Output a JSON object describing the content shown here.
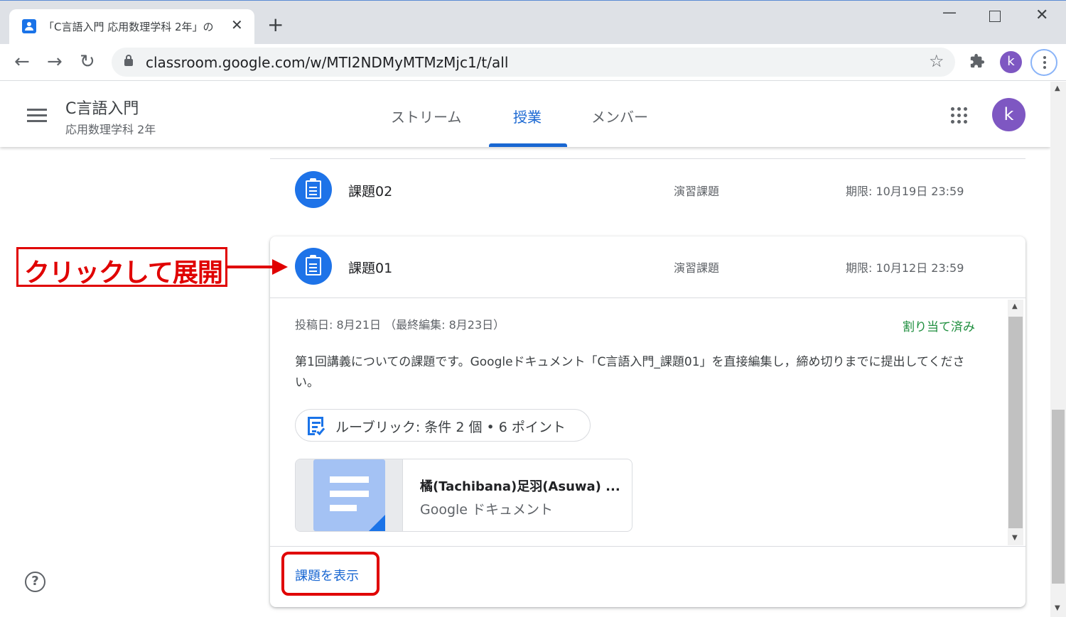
{
  "browser": {
    "tab_title": "「C言語入門 応用数理学科 2年」の",
    "tab_close": "✕",
    "new_tab": "+",
    "url": "classroom.google.com/w/MTI2NDMyMTMzMjc1/t/all",
    "profile_initial": "k",
    "window_controls": {
      "minimize": "—",
      "close": "✕"
    },
    "nav": {
      "back": "←",
      "forward": "→",
      "reload": "↻",
      "star": "☆"
    }
  },
  "classroom": {
    "class_name": "C言語入門",
    "class_section": "応用数理学科 2年",
    "tabs": [
      "ストリーム",
      "授業",
      "メンバー"
    ],
    "active_tab": "授業",
    "avatar_initial": "k",
    "help": "?"
  },
  "assignments": [
    {
      "title": "課題02",
      "topic": "演習課題",
      "due": "期限: 10月19日 23:59"
    },
    {
      "title": "課題01",
      "topic": "演習課題",
      "due": "期限: 10月12日 23:59",
      "posted": "投稿日: 8月21日 （最終編集: 8月23日）",
      "status": "割り当て済み",
      "description": "第1回講義についての課題です。Googleドキュメント「C言語入門_課題01」を直接編集し，締め切りまでに提出してください。",
      "rubric": "ルーブリック: 条件 2 個 • 6 ポイント",
      "attachment": {
        "title": "橘(Tachibana)足羽(Asuwa) ...",
        "type": "Google ドキュメント"
      },
      "view_link": "課題を表示"
    }
  ],
  "annotation": {
    "callout": "クリックして展開",
    "color": "#e00000"
  },
  "colors": {
    "accent": "#1967d2",
    "assignment_icon": "#1e73e8",
    "status_green": "#1e8e3e",
    "avatar": "#7e57c2"
  }
}
